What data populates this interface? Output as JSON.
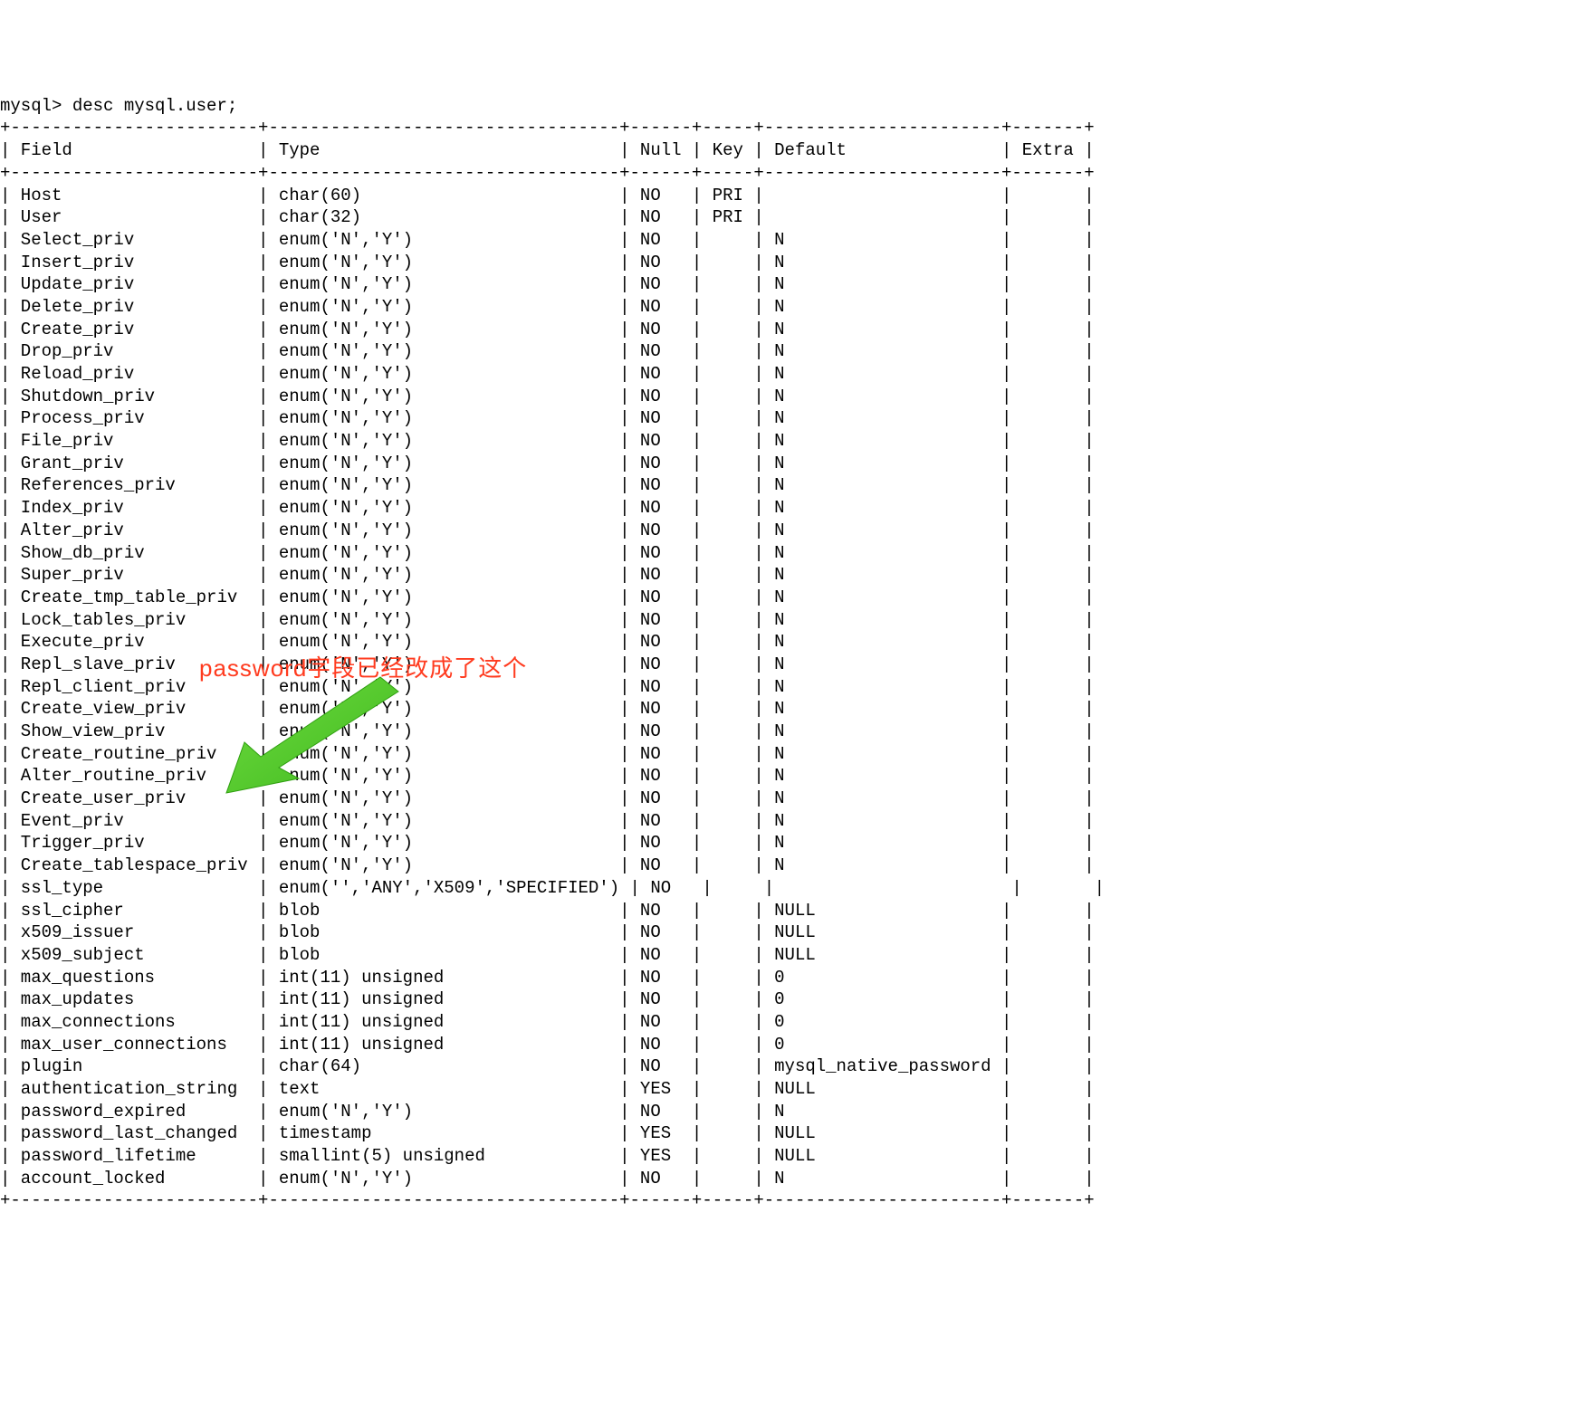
{
  "prompt": "mysql> ",
  "command": "desc mysql.user;",
  "annotation_text": "password字段已经改成了这个",
  "headers": {
    "field": "Field",
    "type": "Type",
    "null": "Null",
    "key": "Key",
    "default": "Default",
    "extra": "Extra"
  },
  "rows": [
    {
      "field": "Host",
      "type": "char(60)",
      "null": "NO",
      "key": "PRI",
      "default": "",
      "extra": ""
    },
    {
      "field": "User",
      "type": "char(32)",
      "null": "NO",
      "key": "PRI",
      "default": "",
      "extra": ""
    },
    {
      "field": "Select_priv",
      "type": "enum('N','Y')",
      "null": "NO",
      "key": "",
      "default": "N",
      "extra": ""
    },
    {
      "field": "Insert_priv",
      "type": "enum('N','Y')",
      "null": "NO",
      "key": "",
      "default": "N",
      "extra": ""
    },
    {
      "field": "Update_priv",
      "type": "enum('N','Y')",
      "null": "NO",
      "key": "",
      "default": "N",
      "extra": ""
    },
    {
      "field": "Delete_priv",
      "type": "enum('N','Y')",
      "null": "NO",
      "key": "",
      "default": "N",
      "extra": ""
    },
    {
      "field": "Create_priv",
      "type": "enum('N','Y')",
      "null": "NO",
      "key": "",
      "default": "N",
      "extra": ""
    },
    {
      "field": "Drop_priv",
      "type": "enum('N','Y')",
      "null": "NO",
      "key": "",
      "default": "N",
      "extra": ""
    },
    {
      "field": "Reload_priv",
      "type": "enum('N','Y')",
      "null": "NO",
      "key": "",
      "default": "N",
      "extra": ""
    },
    {
      "field": "Shutdown_priv",
      "type": "enum('N','Y')",
      "null": "NO",
      "key": "",
      "default": "N",
      "extra": ""
    },
    {
      "field": "Process_priv",
      "type": "enum('N','Y')",
      "null": "NO",
      "key": "",
      "default": "N",
      "extra": ""
    },
    {
      "field": "File_priv",
      "type": "enum('N','Y')",
      "null": "NO",
      "key": "",
      "default": "N",
      "extra": ""
    },
    {
      "field": "Grant_priv",
      "type": "enum('N','Y')",
      "null": "NO",
      "key": "",
      "default": "N",
      "extra": ""
    },
    {
      "field": "References_priv",
      "type": "enum('N','Y')",
      "null": "NO",
      "key": "",
      "default": "N",
      "extra": ""
    },
    {
      "field": "Index_priv",
      "type": "enum('N','Y')",
      "null": "NO",
      "key": "",
      "default": "N",
      "extra": ""
    },
    {
      "field": "Alter_priv",
      "type": "enum('N','Y')",
      "null": "NO",
      "key": "",
      "default": "N",
      "extra": ""
    },
    {
      "field": "Show_db_priv",
      "type": "enum('N','Y')",
      "null": "NO",
      "key": "",
      "default": "N",
      "extra": ""
    },
    {
      "field": "Super_priv",
      "type": "enum('N','Y')",
      "null": "NO",
      "key": "",
      "default": "N",
      "extra": ""
    },
    {
      "field": "Create_tmp_table_priv",
      "type": "enum('N','Y')",
      "null": "NO",
      "key": "",
      "default": "N",
      "extra": ""
    },
    {
      "field": "Lock_tables_priv",
      "type": "enum('N','Y')",
      "null": "NO",
      "key": "",
      "default": "N",
      "extra": ""
    },
    {
      "field": "Execute_priv",
      "type": "enum('N','Y')",
      "null": "NO",
      "key": "",
      "default": "N",
      "extra": ""
    },
    {
      "field": "Repl_slave_priv",
      "type": "enum('N','Y')",
      "null": "NO",
      "key": "",
      "default": "N",
      "extra": ""
    },
    {
      "field": "Repl_client_priv",
      "type": "enum('N','Y')",
      "null": "NO",
      "key": "",
      "default": "N",
      "extra": ""
    },
    {
      "field": "Create_view_priv",
      "type": "enum('N','Y')",
      "null": "NO",
      "key": "",
      "default": "N",
      "extra": ""
    },
    {
      "field": "Show_view_priv",
      "type": "enum('N','Y')",
      "null": "NO",
      "key": "",
      "default": "N",
      "extra": ""
    },
    {
      "field": "Create_routine_priv",
      "type": "enum('N','Y')",
      "null": "NO",
      "key": "",
      "default": "N",
      "extra": ""
    },
    {
      "field": "Alter_routine_priv",
      "type": "enum('N','Y')",
      "null": "NO",
      "key": "",
      "default": "N",
      "extra": ""
    },
    {
      "field": "Create_user_priv",
      "type": "enum('N','Y')",
      "null": "NO",
      "key": "",
      "default": "N",
      "extra": ""
    },
    {
      "field": "Event_priv",
      "type": "enum('N','Y')",
      "null": "NO",
      "key": "",
      "default": "N",
      "extra": ""
    },
    {
      "field": "Trigger_priv",
      "type": "enum('N','Y')",
      "null": "NO",
      "key": "",
      "default": "N",
      "extra": ""
    },
    {
      "field": "Create_tablespace_priv",
      "type": "enum('N','Y')",
      "null": "NO",
      "key": "",
      "default": "N",
      "extra": ""
    },
    {
      "field": "ssl_type",
      "type": "enum('','ANY','X509','SPECIFIED')",
      "null": "NO",
      "key": "",
      "default": "",
      "extra": ""
    },
    {
      "field": "ssl_cipher",
      "type": "blob",
      "null": "NO",
      "key": "",
      "default": "NULL",
      "extra": ""
    },
    {
      "field": "x509_issuer",
      "type": "blob",
      "null": "NO",
      "key": "",
      "default": "NULL",
      "extra": ""
    },
    {
      "field": "x509_subject",
      "type": "blob",
      "null": "NO",
      "key": "",
      "default": "NULL",
      "extra": ""
    },
    {
      "field": "max_questions",
      "type": "int(11) unsigned",
      "null": "NO",
      "key": "",
      "default": "0",
      "extra": ""
    },
    {
      "field": "max_updates",
      "type": "int(11) unsigned",
      "null": "NO",
      "key": "",
      "default": "0",
      "extra": ""
    },
    {
      "field": "max_connections",
      "type": "int(11) unsigned",
      "null": "NO",
      "key": "",
      "default": "0",
      "extra": ""
    },
    {
      "field": "max_user_connections",
      "type": "int(11) unsigned",
      "null": "NO",
      "key": "",
      "default": "0",
      "extra": ""
    },
    {
      "field": "plugin",
      "type": "char(64)",
      "null": "NO",
      "key": "",
      "default": "mysql_native_password",
      "extra": ""
    },
    {
      "field": "authentication_string",
      "type": "text",
      "null": "YES",
      "key": "",
      "default": "NULL",
      "extra": ""
    },
    {
      "field": "password_expired",
      "type": "enum('N','Y')",
      "null": "NO",
      "key": "",
      "default": "N",
      "extra": ""
    },
    {
      "field": "password_last_changed",
      "type": "timestamp",
      "null": "YES",
      "key": "",
      "default": "NULL",
      "extra": ""
    },
    {
      "field": "password_lifetime",
      "type": "smallint(5) unsigned",
      "null": "YES",
      "key": "",
      "default": "NULL",
      "extra": ""
    },
    {
      "field": "account_locked",
      "type": "enum('N','Y')",
      "null": "NO",
      "key": "",
      "default": "N",
      "extra": ""
    }
  ],
  "col_widths": {
    "field": 24,
    "type": 34,
    "null": 6,
    "key": 5,
    "default": 23,
    "extra": 7
  }
}
